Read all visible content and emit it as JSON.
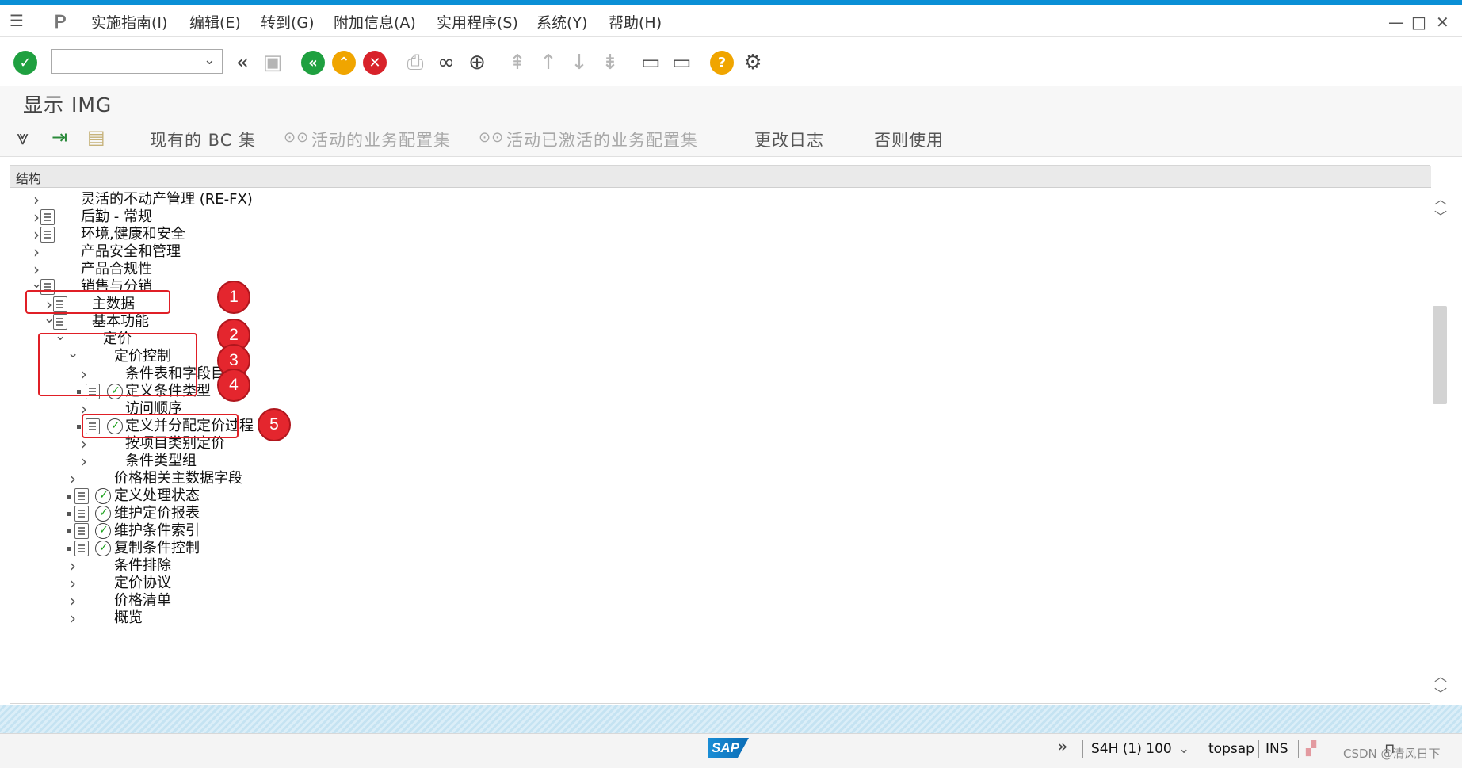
{
  "menubar": {
    "items": [
      "实施指南(I)",
      "编辑(E)",
      "转到(G)",
      "附加信息(A)",
      "实用程序(S)",
      "系统(Y)",
      "帮助(H)"
    ]
  },
  "header": {
    "title": "显示 IMG"
  },
  "app_toolbar": {
    "buttons": [
      {
        "label": "现有的 BC 集",
        "enabled": true
      },
      {
        "label": "活动的业务配置集",
        "enabled": false
      },
      {
        "label": "活动已激活的业务配置集",
        "enabled": false
      },
      {
        "label": "更改日志",
        "enabled": true
      },
      {
        "label": "否则使用",
        "enabled": true
      }
    ]
  },
  "tree": {
    "header": "结构",
    "rows": [
      {
        "label": "灵活的不动产管理 (RE-FX)",
        "level": 0,
        "expander": "collapsed",
        "doc": false,
        "clock": false
      },
      {
        "label": "后勤 - 常规",
        "level": 0,
        "expander": "collapsed",
        "doc": true,
        "clock": false
      },
      {
        "label": "环境,健康和安全",
        "level": 0,
        "expander": "collapsed",
        "doc": true,
        "clock": false
      },
      {
        "label": "产品安全和管理",
        "level": 0,
        "expander": "collapsed",
        "doc": false,
        "clock": false
      },
      {
        "label": "产品合规性",
        "level": 0,
        "expander": "collapsed",
        "doc": false,
        "clock": false
      },
      {
        "label": "销售与分销",
        "level": 0,
        "expander": "expanded",
        "doc": true,
        "clock": false
      },
      {
        "label": "主数据",
        "level": 1,
        "expander": "collapsed",
        "doc": true,
        "clock": false
      },
      {
        "label": "基本功能",
        "level": 1,
        "expander": "expanded",
        "doc": true,
        "clock": false
      },
      {
        "label": "定价",
        "level": 2,
        "expander": "expanded",
        "doc": false,
        "clock": false
      },
      {
        "label": "定价控制",
        "level": 3,
        "expander": "expanded",
        "doc": false,
        "clock": false
      },
      {
        "label": "条件表和字段目录",
        "level": 4,
        "expander": "collapsed",
        "doc": false,
        "clock": false
      },
      {
        "label": "定义条件类型",
        "level": 4,
        "expander": "leaf",
        "doc": true,
        "clock": true
      },
      {
        "label": "访问顺序",
        "level": 4,
        "expander": "collapsed",
        "doc": false,
        "clock": false
      },
      {
        "label": "定义并分配定价过程",
        "level": 4,
        "expander": "leaf",
        "doc": true,
        "clock": true
      },
      {
        "label": "按项目类别定价",
        "level": 4,
        "expander": "collapsed",
        "doc": false,
        "clock": false
      },
      {
        "label": "条件类型组",
        "level": 4,
        "expander": "collapsed",
        "doc": false,
        "clock": false
      },
      {
        "label": "价格相关主数据字段",
        "level": 3,
        "expander": "collapsed",
        "doc": false,
        "clock": false
      },
      {
        "label": "定义处理状态",
        "level": 3,
        "expander": "leaf",
        "doc": true,
        "clock": true
      },
      {
        "label": "维护定价报表",
        "level": 3,
        "expander": "leaf",
        "doc": true,
        "clock": true
      },
      {
        "label": "维护条件索引",
        "level": 3,
        "expander": "leaf",
        "doc": true,
        "clock": true
      },
      {
        "label": "复制条件控制",
        "level": 3,
        "expander": "leaf",
        "doc": true,
        "clock": true
      },
      {
        "label": "条件排除",
        "level": 3,
        "expander": "collapsed",
        "doc": false,
        "clock": false
      },
      {
        "label": "定价协议",
        "level": 3,
        "expander": "collapsed",
        "doc": false,
        "clock": false
      },
      {
        "label": "价格清单",
        "level": 3,
        "expander": "collapsed",
        "doc": false,
        "clock": false
      },
      {
        "label": "概览",
        "level": 3,
        "expander": "collapsed",
        "doc": false,
        "clock": false
      }
    ]
  },
  "annotations": [
    "1",
    "2",
    "3",
    "4",
    "5"
  ],
  "statusbar": {
    "logo": "SAP",
    "system": "S4H (1) 100",
    "user": "topsap",
    "mode": "INS",
    "watermark": "CSDN @清风日下"
  },
  "colors": {
    "accent": "#0a8fd6",
    "annotation_red": "#e4262e",
    "enter_green": "#1fa040",
    "nav_orange": "#f0a500",
    "cancel_red": "#d8222a"
  }
}
